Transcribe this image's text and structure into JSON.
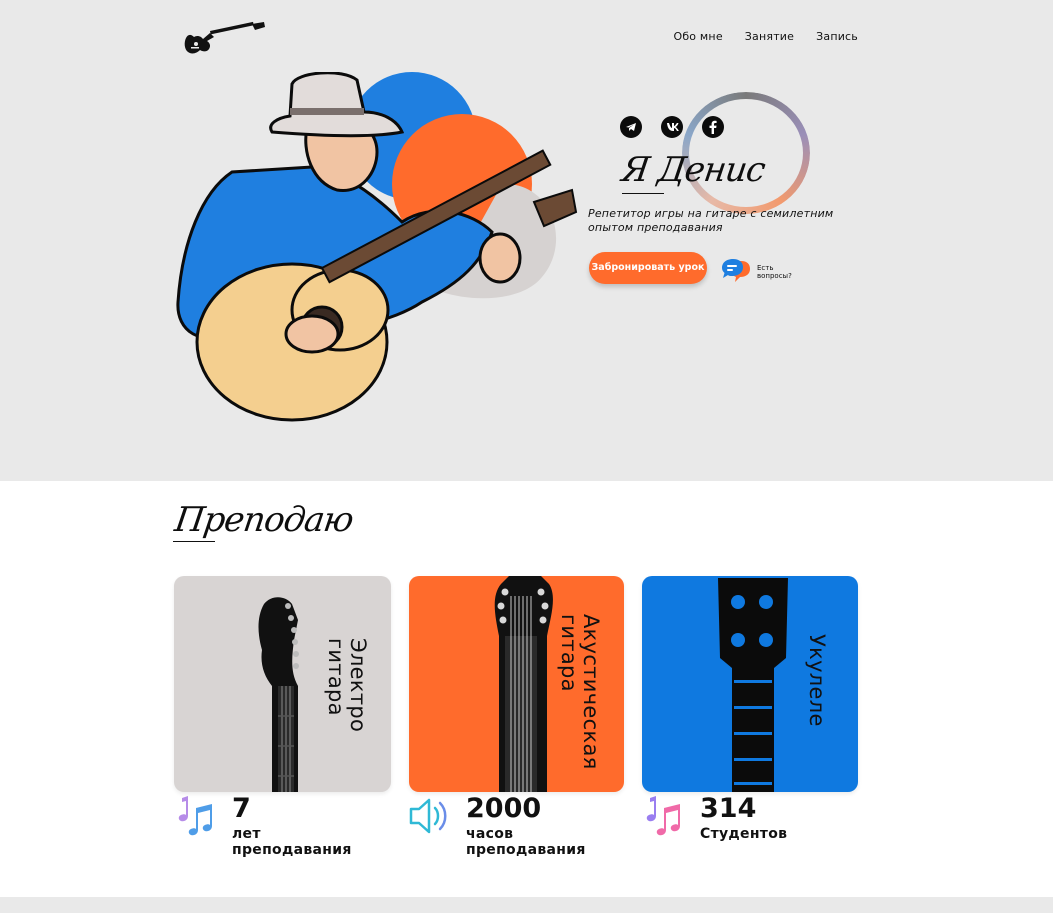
{
  "nav": {
    "items": [
      "Обо мне",
      "Занятие",
      "Запись"
    ]
  },
  "hero": {
    "title": "Я Денис",
    "subtitle": "Репетитор игры на гитаре с семилетним опытом преподавания",
    "book_button": "Забронировать урок",
    "faq_text": "Есть вопросы?",
    "socials": [
      "telegram-icon",
      "vk-icon",
      "facebook-icon"
    ]
  },
  "teach": {
    "title": "Преподаю",
    "cards": [
      {
        "label": "Электро гитара",
        "color": "#d8d4d3"
      },
      {
        "label": "Акустическая гитара",
        "color": "#ff6b2c"
      },
      {
        "label": "Укулеле",
        "color": "#0f79e0"
      }
    ]
  },
  "stats": [
    {
      "value": "7",
      "label": "лет преподавания",
      "icon": "music-notes-icon"
    },
    {
      "value": "2000",
      "label": "часов преподавания",
      "icon": "speaker-icon"
    },
    {
      "value": "314",
      "label": "Студентов",
      "icon": "music-notes-icon"
    }
  ],
  "colors": {
    "accent_orange": "#ff6b2c",
    "accent_blue": "#0f79e0",
    "hero_bg": "#e9e9e9"
  }
}
